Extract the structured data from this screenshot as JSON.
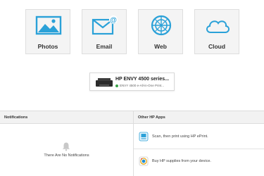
{
  "tiles": [
    {
      "label": "Photos",
      "icon": "photos-icon"
    },
    {
      "label": "Email",
      "icon": "email-icon"
    },
    {
      "label": "Web",
      "icon": "web-icon"
    },
    {
      "label": "Cloud",
      "icon": "cloud-icon"
    }
  ],
  "printer": {
    "name": "HP ENVY 4500 series...",
    "status": "ENVY 4500 e-All-in-One Print..."
  },
  "notifications": {
    "header": "Notifications",
    "empty_text": "There Are No Notifications"
  },
  "other_apps": {
    "header": "Other HP Apps",
    "items": [
      {
        "text": "Scan, then print using HP ePrint.",
        "icon": "scan-app-icon"
      },
      {
        "text": "Buy HP supplies from your device.",
        "icon": "supplies-app-icon"
      }
    ]
  },
  "colors": {
    "accent": "#2aa1d8",
    "tile_bg": "#f4f4f4",
    "header_bg": "#f2f2f2",
    "status_green": "#3aa34a"
  }
}
